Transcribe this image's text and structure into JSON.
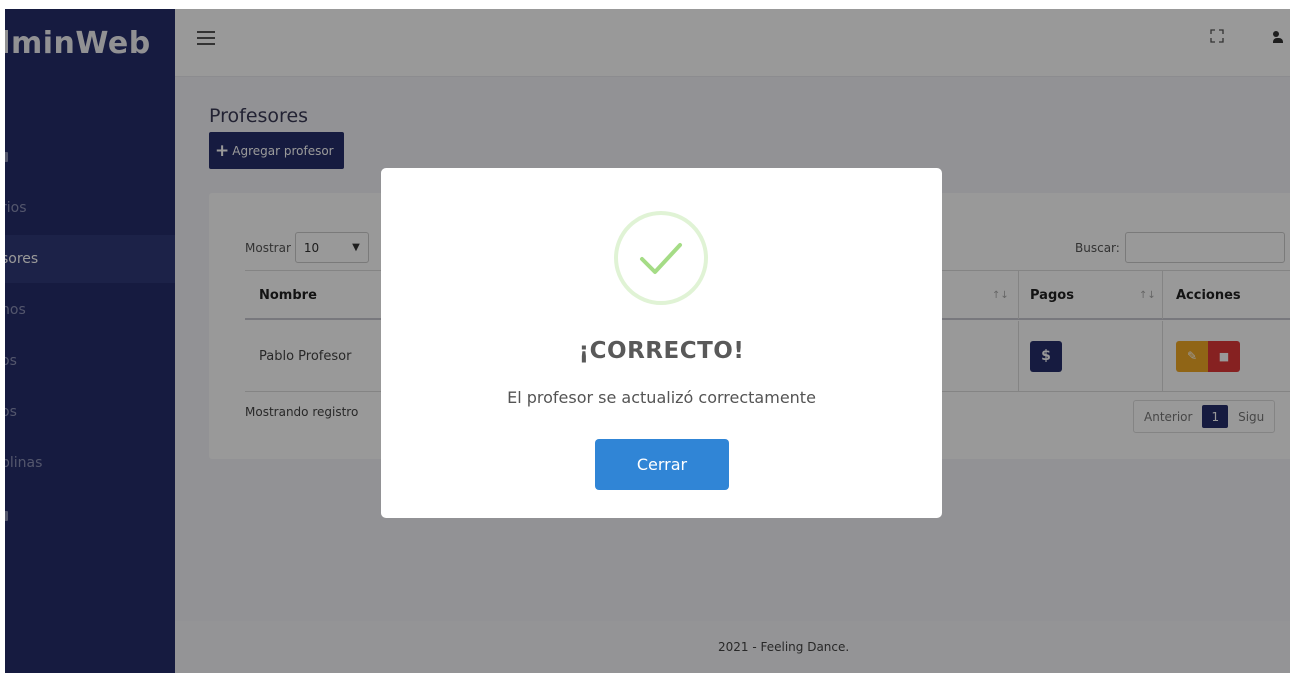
{
  "brand": "dminWeb",
  "sidebar": {
    "items": [
      {
        "label": ""
      },
      {
        "label": "rios"
      },
      {
        "label": "sores"
      },
      {
        "label": "nos"
      },
      {
        "label": "os"
      },
      {
        "label": "os"
      },
      {
        "label": "plinas"
      },
      {
        "label": ""
      }
    ]
  },
  "topbar": {
    "fullscreen_icon": "expand-icon",
    "user_icon": "user-icon"
  },
  "page": {
    "title": "Profesores",
    "add_label": "Agregar profesor"
  },
  "table": {
    "show_label": "Mostrar",
    "show_value": "10",
    "search_label": "Buscar:",
    "columns": [
      "Nombre",
      "Pagos",
      "Acciones"
    ],
    "rows": [
      {
        "nombre": "Pablo Profesor",
        "pago_label": "$"
      }
    ],
    "info": "Mostrando registro",
    "prev_label": "Anterior",
    "current_page": "1",
    "next_label": "Sigu"
  },
  "footer": {
    "text": "2021 - Feeling Dance."
  },
  "modal": {
    "title": "¡CORRECTO!",
    "message": "El profesor se actualizó correctamente",
    "button_label": "Cerrar",
    "accent_color": "#3085d6",
    "success_color": "#a5dc86"
  }
}
